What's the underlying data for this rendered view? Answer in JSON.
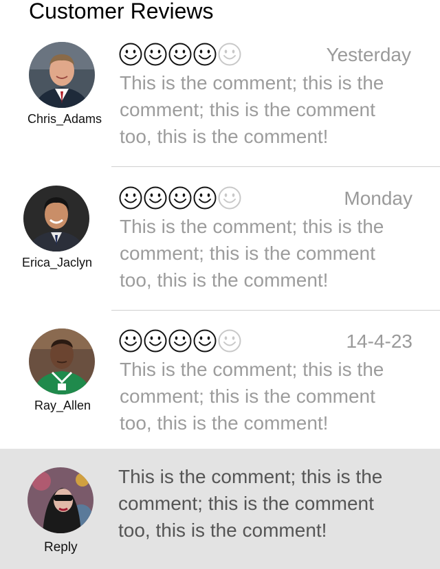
{
  "header": {
    "title": "Customer Reviews"
  },
  "reviews": [
    {
      "name": "Chris_Adams",
      "date": "Yesterday",
      "rating": 4,
      "max_rating": 5,
      "comment_lines": [
        "This is the comment; this is the",
        "comment; this is the comment",
        "too, this is the comment!"
      ]
    },
    {
      "name": "Erica_Jaclyn",
      "date": "Monday",
      "rating": 4,
      "max_rating": 5,
      "comment_lines": [
        "This is the comment; this is the",
        "comment; this is the comment",
        "too, this is the comment!"
      ]
    },
    {
      "name": "Ray_Allen",
      "date": "14-4-23",
      "rating": 4,
      "max_rating": 5,
      "comment_lines": [
        "This is the comment; this is the",
        "comment; this is the comment",
        "too, this is the comment!"
      ]
    }
  ],
  "reply": {
    "label": "Reply",
    "text_lines": [
      "This is the comment; this is the",
      "comment; this is the comment",
      "too, this is the comment!"
    ]
  },
  "colors": {
    "divider": "#cfcfcf",
    "muted_text": "#9c9c9c",
    "reply_background": "#e3e3e3",
    "face_filled": "#111111",
    "face_empty": "#c8c8c8"
  },
  "icons": {
    "rating": "smiley-face-icon"
  }
}
